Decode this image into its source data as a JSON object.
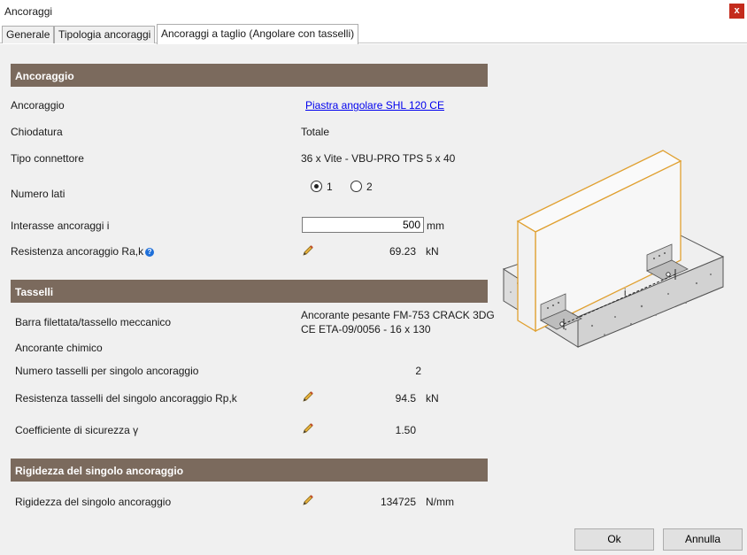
{
  "window": {
    "title": "Ancoraggi",
    "close_label": "x"
  },
  "tabs": [
    {
      "label": "Generale"
    },
    {
      "label": "Tipologia ancoraggi"
    },
    {
      "label": "Ancoraggi a taglio (Angolare con tasselli)"
    }
  ],
  "help_label": "?",
  "ancoraggio": {
    "header": "Ancoraggio",
    "ancoraggio_label": "Ancoraggio",
    "ancoraggio_value": "Piastra angolare SHL 120 CE",
    "chiodatura_label": "Chiodatura",
    "chiodatura_value": "Totale",
    "tipo_connettore_label": "Tipo connettore",
    "tipo_connettore_value": "36  x  Vite - VBU-PRO TPS 5 x 40",
    "numero_lati_label": "Numero lati",
    "numero_lati_options": [
      "1",
      "2"
    ],
    "numero_lati_selected": "1",
    "interasse_label": "Interasse ancoraggi i",
    "interasse_value": "500",
    "interasse_unit": "mm",
    "resistenza_label": "Resistenza ancoraggio Ra,k",
    "resistenza_value": "69.23",
    "resistenza_unit": "kN"
  },
  "tasselli": {
    "header": "Tasselli",
    "barra_label": "Barra filettata/tassello meccanico",
    "barra_value_line1": "Ancorante pesante FM-753 CRACK 3DG",
    "barra_value_line2": "CE ETA-09/0056 - 16 x 130",
    "chimico_label": "Ancorante chimico",
    "numero_label": "Numero tasselli per singolo ancoraggio",
    "numero_value": "2",
    "resistenza_label": "Resistenza tasselli del singolo ancoraggio Rp,k",
    "resistenza_value": "94.5",
    "resistenza_unit": "kN",
    "coeff_label": "Coefficiente di sicurezza γ",
    "coeff_value": "1.50"
  },
  "rigidezza": {
    "header": "Rigidezza del singolo ancoraggio",
    "label": "Rigidezza del singolo ancoraggio",
    "value": "134725",
    "unit": "N/mm"
  },
  "illustration": {
    "dimension_label": "i"
  },
  "footer": {
    "ok_label": "Ok",
    "cancel_label": "Annulla"
  },
  "colors": {
    "section_header": "#7b6a5d",
    "close_button": "#c42b1c",
    "wood_outline": "#e0a030",
    "link": "#0000ee"
  }
}
